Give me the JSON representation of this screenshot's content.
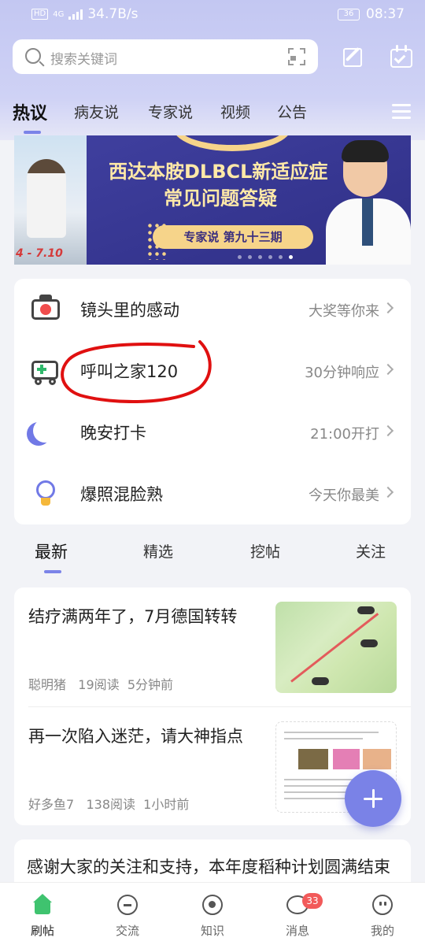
{
  "status_bar": {
    "network_speed": "34.7B/s",
    "signal_label": "HD",
    "network_gen": "4G",
    "battery": "36",
    "time": "08:37"
  },
  "search": {
    "placeholder": "搜索关键词"
  },
  "top_tabs": [
    {
      "label": "热议",
      "active": true
    },
    {
      "label": "病友说"
    },
    {
      "label": "专家说"
    },
    {
      "label": "视频"
    },
    {
      "label": "公告"
    }
  ],
  "banner": {
    "left_date": "4 - 7.10",
    "title_line1": "西达本胺DLBCL新适应症",
    "title_line2": "常见问题答疑",
    "pill": "专家说 第九十三期"
  },
  "features": [
    {
      "name": "镜头里的感动",
      "sub": "大奖等你来",
      "icon": "camera-icon"
    },
    {
      "name": "呼叫之家120",
      "sub": "30分钟响应",
      "icon": "ambulance-icon"
    },
    {
      "name": "晚安打卡",
      "sub": "21:00开打",
      "icon": "moon-icon"
    },
    {
      "name": "爆照混脸熟",
      "sub": "今天你最美",
      "icon": "lightbulb-icon"
    }
  ],
  "feed_tabs": [
    {
      "label": "最新",
      "active": true
    },
    {
      "label": "精选"
    },
    {
      "label": "挖帖"
    },
    {
      "label": "关注"
    }
  ],
  "posts": [
    {
      "title": "结疗满两年了，7月德国转转",
      "author": "聪明猪",
      "reads": "19阅读",
      "time": "5分钟前"
    },
    {
      "title": "再一次陷入迷茫，请大神指点",
      "author": "好多鱼7",
      "reads": "138阅读",
      "time": "1小时前"
    },
    {
      "title": "感谢大家的关注和支持，本年度稻种计划圆满结束"
    }
  ],
  "bottom_nav": [
    {
      "label": "刷帖",
      "icon": "home-icon",
      "active": true
    },
    {
      "label": "交流",
      "icon": "chat-icon"
    },
    {
      "label": "知识",
      "icon": "knowledge-icon"
    },
    {
      "label": "消息",
      "icon": "message-icon",
      "badge": "33"
    },
    {
      "label": "我的",
      "icon": "profile-icon"
    }
  ],
  "colors": {
    "accent": "#7a82e7",
    "badge": "#f25a5a",
    "annotation": "#e01010",
    "home_active": "#3fc36f"
  }
}
